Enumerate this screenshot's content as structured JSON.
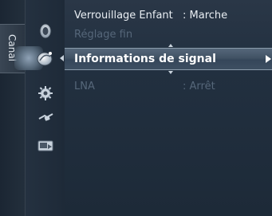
{
  "tab": {
    "label": "Canal"
  },
  "icons": [
    {
      "name": "picture-icon"
    },
    {
      "name": "channel-antenna-icon"
    },
    {
      "name": "setup-gear-icon"
    },
    {
      "name": "input-plug-icon"
    },
    {
      "name": "application-icon"
    }
  ],
  "menu": {
    "items": [
      {
        "label": "Verrouillage Enfant",
        "value": ": Marche",
        "state": "normal"
      },
      {
        "label": "Réglage fin",
        "value": "",
        "state": "dim"
      },
      {
        "label": "Informations de signal",
        "value": "",
        "state": "selected"
      },
      {
        "label": "LNA",
        "value": ": Arrêt",
        "state": "dim"
      }
    ]
  },
  "colors": {
    "highlight": "#415264",
    "text_normal": "#e9eef3",
    "text_dim": "#56677a"
  }
}
